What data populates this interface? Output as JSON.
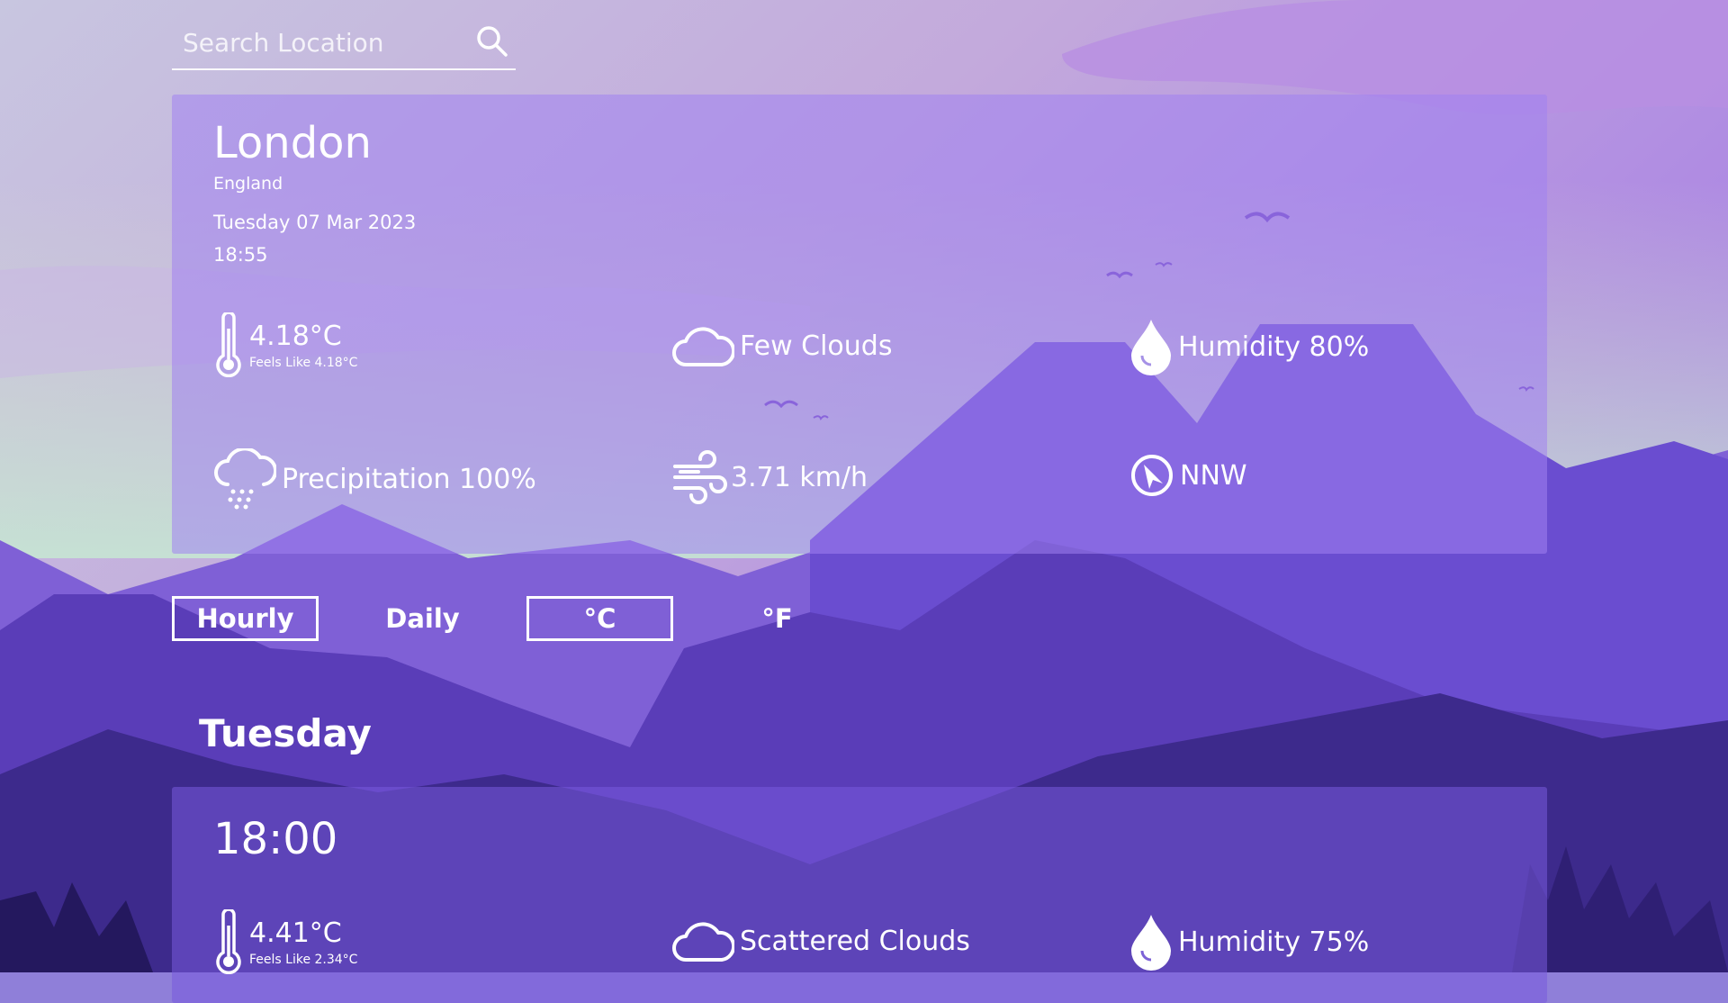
{
  "search": {
    "placeholder": "Search Location"
  },
  "current": {
    "city": "London",
    "country": "England",
    "date": "Tuesday 07 Mar 2023",
    "time": "18:55",
    "temperature": "4.18°C",
    "feels_like": "Feels Like 4.18°C",
    "description": "Few Clouds",
    "humidity": "Humidity 80%",
    "precipitation": "Precipitation 100%",
    "wind_speed": "3.71 km/h",
    "wind_direction": "NNW"
  },
  "toggles": {
    "hourly": "Hourly",
    "daily": "Daily",
    "celsius": "°C",
    "fahrenheit": "°F"
  },
  "forecast": {
    "day": "Tuesday",
    "hours": [
      {
        "time": "18:00",
        "temperature": "4.41°C",
        "feels_like": "Feels Like 2.34°C",
        "description": "Scattered Clouds",
        "humidity": "Humidity 75%"
      }
    ]
  },
  "icons": {
    "search": "search-icon",
    "thermometer": "thermometer-icon",
    "cloud": "cloud-icon",
    "humidity": "water-drop-icon",
    "rain": "rain-cloud-icon",
    "wind": "wind-icon",
    "compass": "compass-icon"
  }
}
